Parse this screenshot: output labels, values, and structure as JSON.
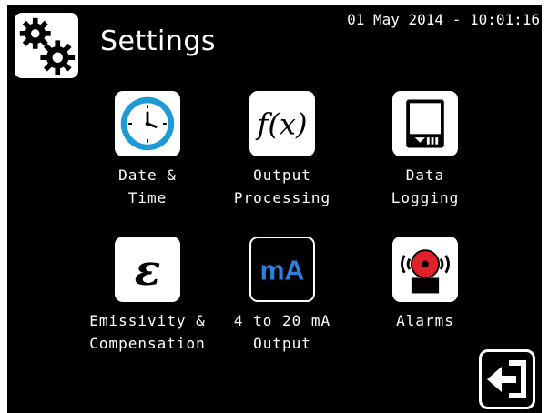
{
  "header": {
    "icon": "gears-icon",
    "title": "Settings",
    "datetime": "01 May 2014 - 10:01:16"
  },
  "tiles": [
    {
      "icon": "clock-icon",
      "line1": "Date &",
      "line2": "Time"
    },
    {
      "icon": "function-fx-icon",
      "symbol": "f(x)",
      "line1": "Output",
      "line2": "Processing"
    },
    {
      "icon": "sd-card-icon",
      "line1": "Data",
      "line2": "Logging"
    },
    {
      "icon": "epsilon-icon",
      "symbol": "ε",
      "line1": "Emissivity &",
      "line2": "Compensation"
    },
    {
      "icon": "milliamp-icon",
      "symbol": "mA",
      "line1": "4 to 20 mA",
      "line2": "Output"
    },
    {
      "icon": "alarm-bell-icon",
      "line1": "Alarms",
      "line2": ""
    }
  ],
  "exit": {
    "icon": "exit-arrow-icon"
  },
  "colors": {
    "background": "#000000",
    "foreground": "#ffffff",
    "clock_face": "#1e9bd7",
    "ma_text": "#2f7fe0",
    "alarm_red": "#e0202a"
  }
}
